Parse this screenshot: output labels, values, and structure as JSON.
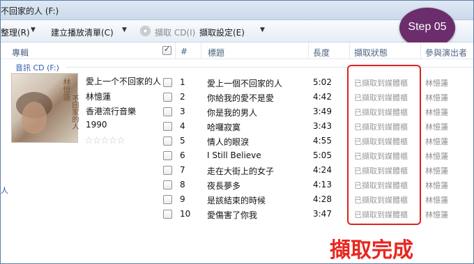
{
  "window": {
    "title": "不回家的人 (F:)"
  },
  "toolbar": {
    "organize": "整理(R)",
    "create_playlist": "建立播放清單(C)",
    "rip_cd": "擷取 CD(I)",
    "rip_settings": "擷取設定(E)"
  },
  "badge": {
    "label": "Step 05"
  },
  "columns": {
    "album": "專輯",
    "number": "#",
    "title": "標題",
    "length": "長度",
    "rip_status": "擷取狀態",
    "contributing_artist": "參與演出者"
  },
  "group": {
    "label": "音訊 CD (F:)"
  },
  "album_info": {
    "title": "愛上一个不回家的人",
    "artist": "林憶蓮",
    "genre": "香港流行音樂",
    "year": "1990",
    "rating_stars": 0,
    "cover_text_artist": "林憶蓮",
    "cover_text_title": "不回家的人"
  },
  "tracks": [
    {
      "number": "1",
      "title": "愛上一個不回家的人",
      "length": "5:02",
      "status": "已擷取到媒體櫃",
      "artist": "林憶蓮"
    },
    {
      "number": "2",
      "title": "你給我的愛不是愛",
      "length": "4:42",
      "status": "已擷取到媒體櫃",
      "artist": "林憶蓮"
    },
    {
      "number": "3",
      "title": "你是我的男人",
      "length": "3:49",
      "status": "已擷取到媒體櫃",
      "artist": "林憶蓮"
    },
    {
      "number": "4",
      "title": "哈囉寂寞",
      "length": "3:43",
      "status": "已擷取到媒體櫃",
      "artist": "林憶蓮"
    },
    {
      "number": "5",
      "title": "情人的眼淚",
      "length": "4:55",
      "status": "已擷取到媒體櫃",
      "artist": "林憶蓮"
    },
    {
      "number": "6",
      "title": "I Still Believe",
      "length": "5:05",
      "status": "已擷取到媒體櫃",
      "artist": "林憶蓮"
    },
    {
      "number": "7",
      "title": "走在大街上的女子",
      "length": "4:24",
      "status": "已擷取到媒體櫃",
      "artist": "林憶蓮"
    },
    {
      "number": "8",
      "title": "夜長夢多",
      "length": "4:13",
      "status": "已擷取到媒體櫃",
      "artist": "林憶蓮"
    },
    {
      "number": "9",
      "title": "是該結束的時候",
      "length": "4:28",
      "status": "已擷取到媒體櫃",
      "artist": "林憶蓮"
    },
    {
      "number": "10",
      "title": "愛傷害了你我",
      "length": "3:47",
      "status": "已擷取到媒體櫃",
      "artist": "林憶蓮"
    }
  ],
  "annotation": {
    "label": "擷取完成"
  },
  "left_pane_fragment": "人",
  "colors": {
    "highlight_box": "#e02020",
    "annotation": "#e8261f",
    "badge": "#6b2d6c"
  }
}
